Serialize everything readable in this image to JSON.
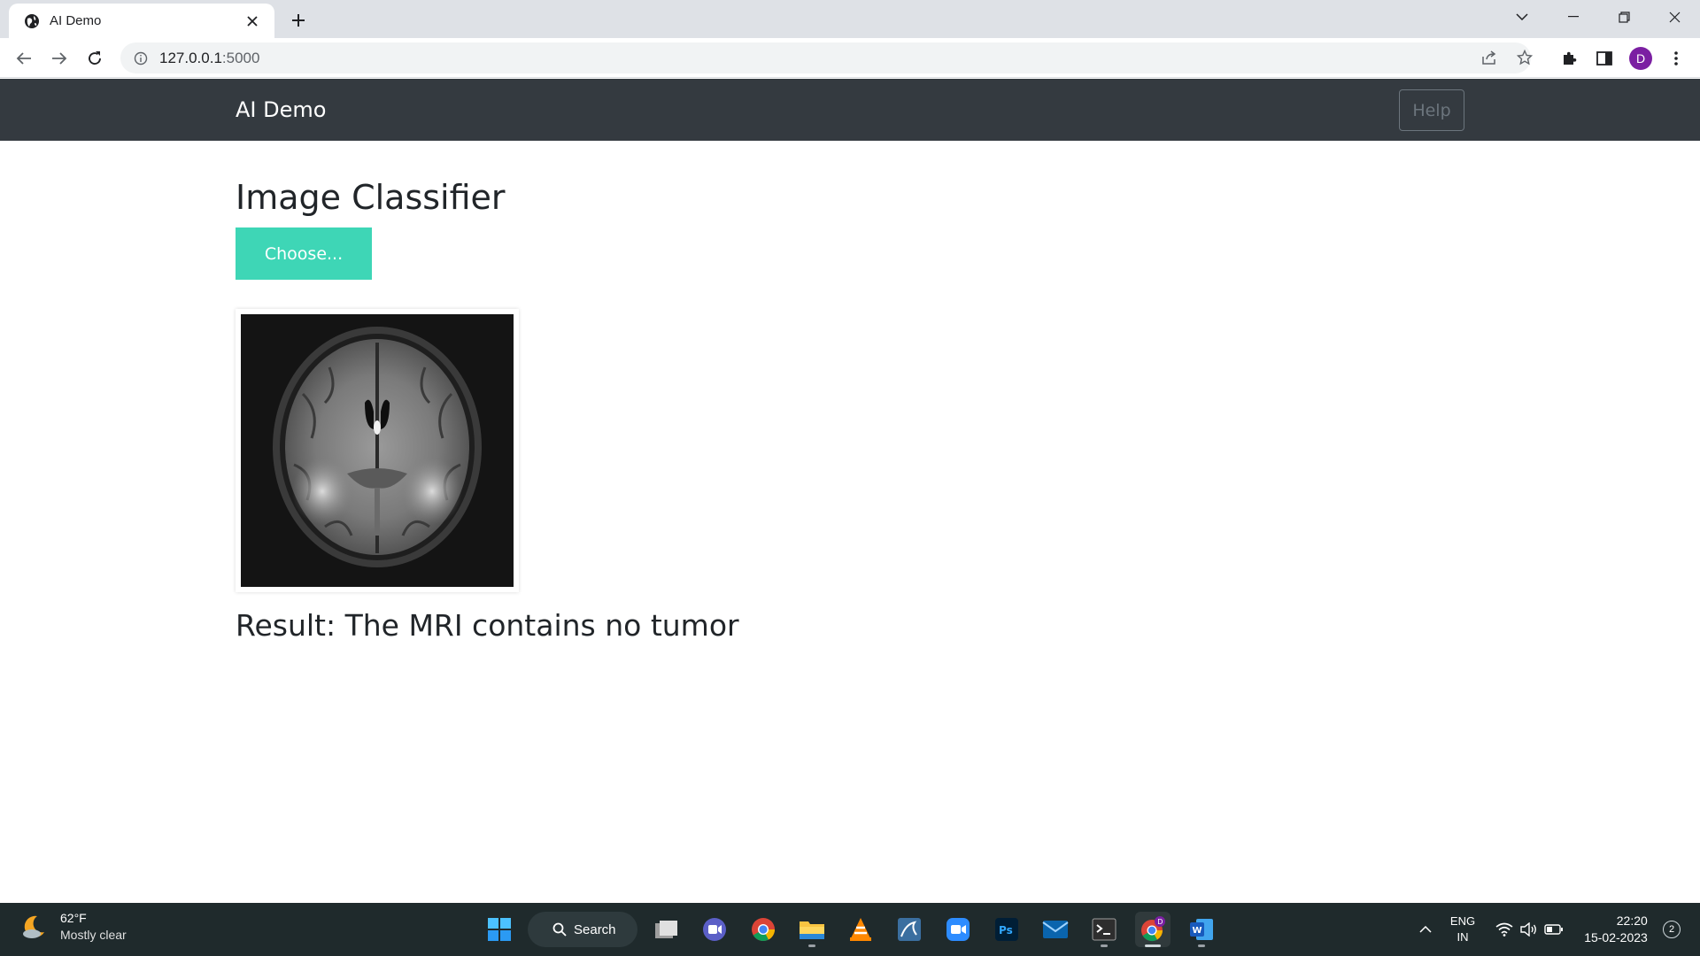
{
  "browser": {
    "tab_title": "AI Demo",
    "url_host": "127.0.0.1",
    "url_port": ":5000",
    "profile_initial": "D"
  },
  "page": {
    "brand": "AI Demo",
    "help_label": "Help",
    "title": "Image Classifier",
    "choose_label": "Choose...",
    "result_text": "Result: The MRI contains no tumor",
    "accent_color": "#3ed6b6",
    "navbar_color": "#343a40"
  },
  "taskbar": {
    "weather_temp": "62°F",
    "weather_condition": "Mostly clear",
    "search_label": "Search",
    "lang_line1": "ENG",
    "lang_line2": "IN",
    "time": "22:20",
    "date": "15-02-2023",
    "notification_count": "2",
    "chrome_badge": "D",
    "apps": [
      "start-icon",
      "task-view-icon",
      "teams-chat-icon",
      "chrome-icon",
      "file-explorer-icon",
      "vlc-icon",
      "mysql-workbench-icon",
      "zoom-icon",
      "photoshop-icon",
      "mail-icon",
      "terminal-icon",
      "chrome-profile-icon",
      "word-icon"
    ]
  }
}
